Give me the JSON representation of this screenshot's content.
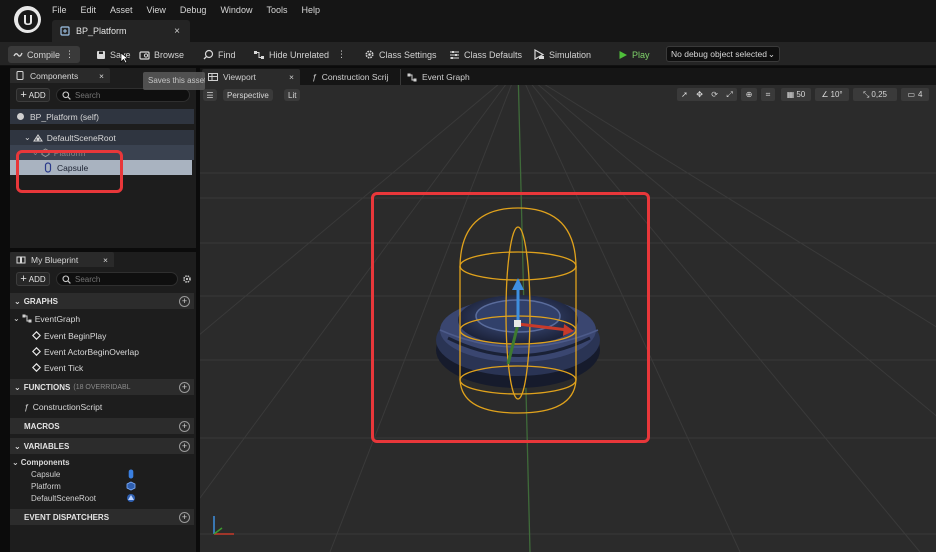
{
  "menu": [
    "File",
    "Edit",
    "Asset",
    "View",
    "Debug",
    "Window",
    "Tools",
    "Help"
  ],
  "doc_tab": {
    "label": "BP_Platform",
    "close": "×"
  },
  "toolbar": {
    "compile": "Compile",
    "save": "Save",
    "browse": "Browse",
    "find": "Find",
    "hide_unrelated": "Hide Unrelated",
    "class_settings": "Class Settings",
    "class_defaults": "Class Defaults",
    "simulation": "Simulation",
    "play": "Play",
    "debug_select": "No debug object selected",
    "save_tooltip": "Saves this asset"
  },
  "components_panel": {
    "tab": "Components",
    "add": "ADD",
    "search_placeholder": "Search",
    "self": "BP_Platform (self)",
    "tree": [
      "DefaultSceneRoot",
      "Platform",
      "Capsule"
    ]
  },
  "blueprint_panel": {
    "tab": "My Blueprint",
    "add": "ADD",
    "search_placeholder": "Search",
    "graphs_label": "GRAPHS",
    "event_graph": "EventGraph",
    "events": [
      "Event BeginPlay",
      "Event ActorBeginOverlap",
      "Event Tick"
    ],
    "functions_label": "FUNCTIONS",
    "functions_note": "(18 OVERRIDABL",
    "construction_script": "ConstructionScript",
    "macros_label": "MACROS",
    "variables_label": "VARIABLES",
    "components_group": "Components",
    "variables": [
      "Capsule",
      "Platform",
      "DefaultSceneRoot"
    ],
    "dispatchers_label": "EVENT DISPATCHERS"
  },
  "viewport_tabs": [
    "Viewport",
    "Construction Scrij",
    "Event Graph"
  ],
  "viewport": {
    "perspective": "Perspective",
    "lit": "Lit",
    "grid_size": "50",
    "rotation_snap": "10°",
    "scale_snap": "0,25",
    "camera_speed": "4"
  },
  "colors": {
    "highlight": "#e8373a",
    "play_green": "#4fbf3a",
    "gizmo_yellow": "#e0a21c",
    "gizmo_blue": "#3e8fe0",
    "gizmo_red": "#c83a2a"
  }
}
